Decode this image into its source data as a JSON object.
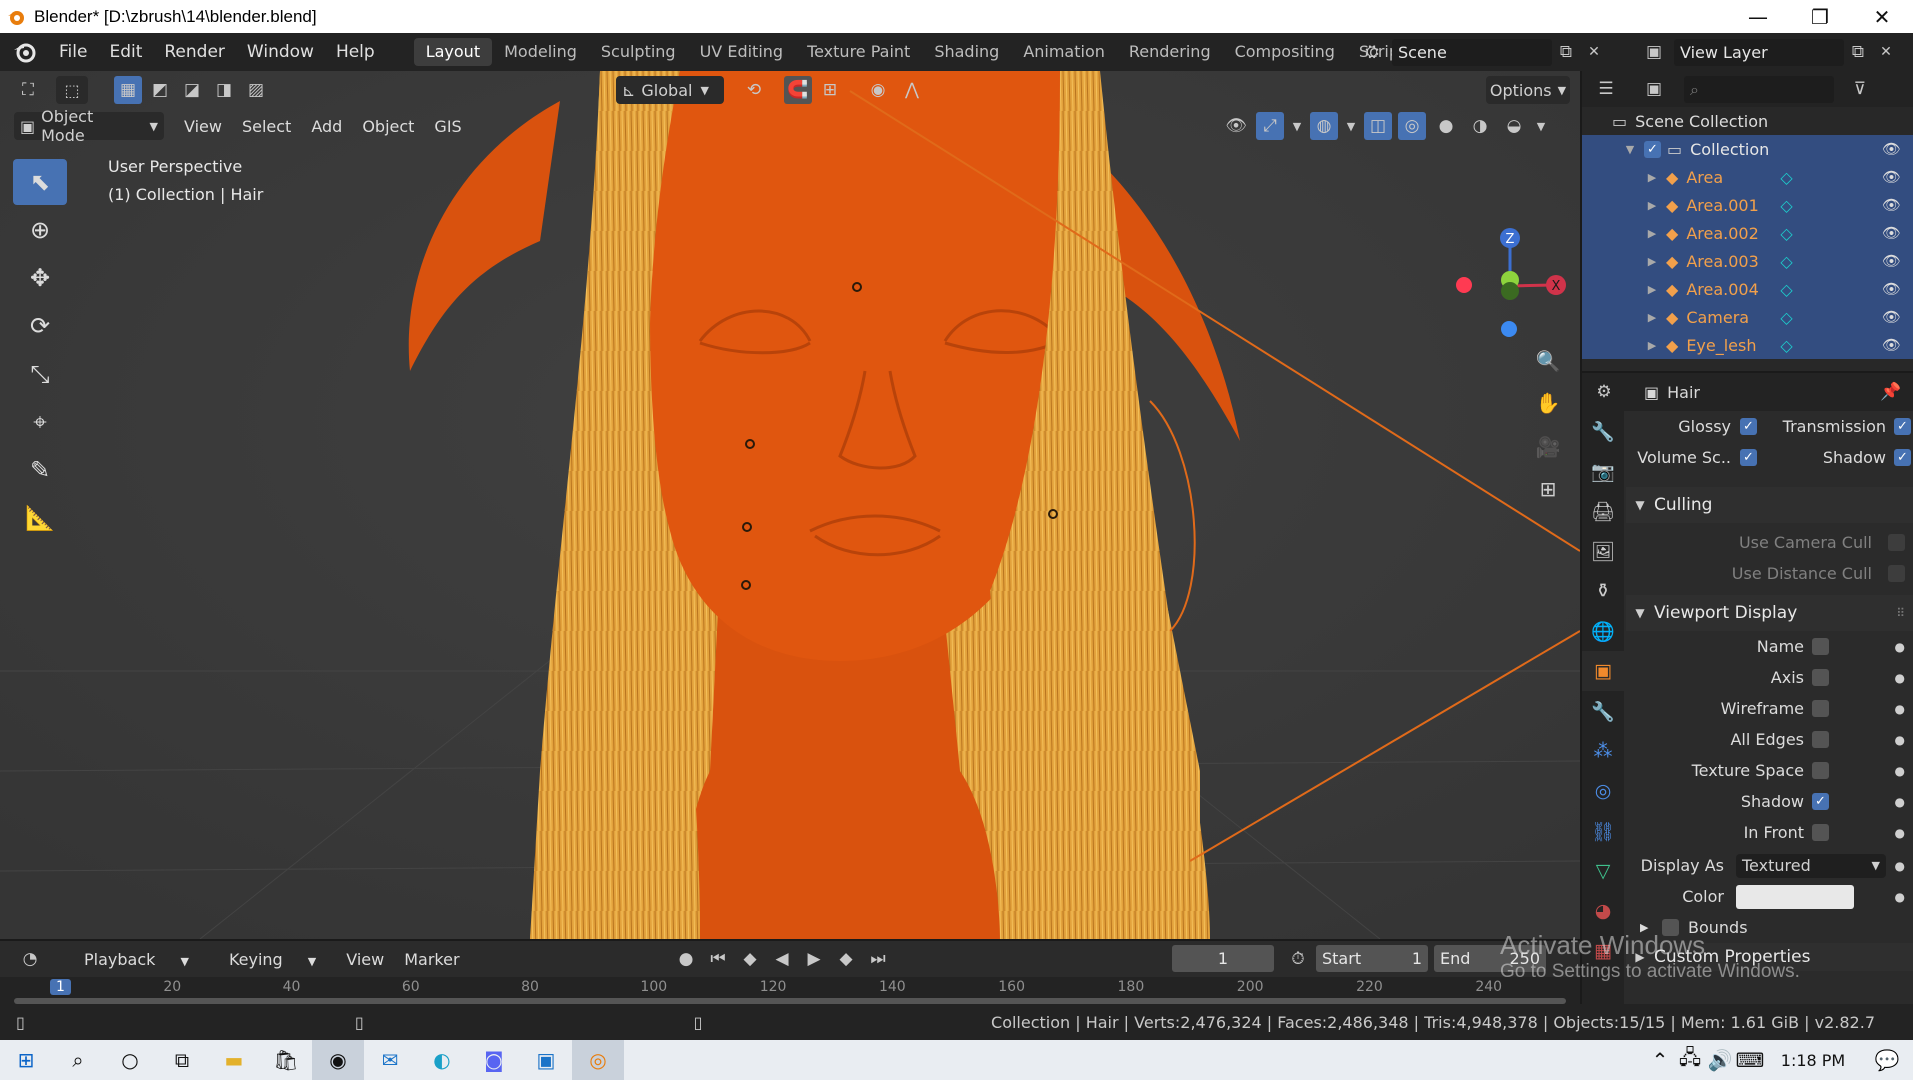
{
  "window": {
    "title": "Blender* [D:\\zbrush\\14\\blender.blend]",
    "minimize": "—",
    "maximize": "❐",
    "close": "✕"
  },
  "menu": [
    "File",
    "Edit",
    "Render",
    "Window",
    "Help"
  ],
  "workspaces": [
    "Layout",
    "Modeling",
    "Sculpting",
    "UV Editing",
    "Texture Paint",
    "Shading",
    "Animation",
    "Rendering",
    "Compositing",
    "Scripting"
  ],
  "active_workspace": "Layout",
  "scene": {
    "name": "Scene",
    "view_layer": "View Layer"
  },
  "viewport": {
    "transform_orientation": "Global",
    "options_label": "Options",
    "mode": "Object Mode",
    "menus": [
      "View",
      "Select",
      "Add",
      "Object",
      "GIS"
    ],
    "info_line1": "User Perspective",
    "info_line2": "(1) Collection | Hair",
    "gizmo_axes": {
      "z": "Z",
      "x": "X"
    }
  },
  "outliner": {
    "root": "Scene Collection",
    "collection": "Collection",
    "items": [
      {
        "name": "Area",
        "icon_color": "#1ec9c9"
      },
      {
        "name": "Area.001",
        "icon_color": "#1ec9c9"
      },
      {
        "name": "Area.002",
        "icon_color": "#1ec9c9"
      },
      {
        "name": "Area.003",
        "icon_color": "#1ec9c9"
      },
      {
        "name": "Area.004",
        "icon_color": "#1ec9c9"
      },
      {
        "name": "Camera",
        "icon_color": "#1ec9c9"
      },
      {
        "name": "Eye_lesh",
        "icon_color": "#1ec9c9"
      }
    ]
  },
  "properties": {
    "object_name": "Hair",
    "visibility": {
      "glossy": "Glossy",
      "transmission": "Transmission",
      "volume": "Volume Sc..",
      "shadow": "Shadow"
    },
    "culling": {
      "title": "Culling",
      "camera_cull": "Use Camera Cull",
      "distance_cull": "Use Distance Cull"
    },
    "viewport_display": {
      "title": "Viewport Display",
      "rows": [
        {
          "label": "Name",
          "checked": false
        },
        {
          "label": "Axis",
          "checked": false
        },
        {
          "label": "Wireframe",
          "checked": false
        },
        {
          "label": "All Edges",
          "checked": false
        },
        {
          "label": "Texture Space",
          "checked": false
        },
        {
          "label": "Shadow",
          "checked": true
        },
        {
          "label": "In Front",
          "checked": false
        }
      ],
      "display_as_label": "Display As",
      "display_as_value": "Textured",
      "color_label": "Color",
      "bounds_label": "Bounds"
    },
    "custom_properties": "Custom Properties"
  },
  "timeline": {
    "menus": [
      "Playback",
      "Keying",
      "View",
      "Marker"
    ],
    "current_frame": "1",
    "start_label": "Start",
    "start_value": "1",
    "end_label": "End",
    "end_value": "250",
    "ruler": [
      "1",
      "20",
      "40",
      "60",
      "80",
      "100",
      "120",
      "140",
      "160",
      "180",
      "200",
      "220",
      "240"
    ]
  },
  "statusbar": "Collection | Hair | Verts:2,476,324 | Faces:2,486,348 | Tris:4,948,378 | Objects:15/15 | Mem: 1.61 GiB | v2.82.7",
  "watermark": {
    "line1": "Activate Windows",
    "line2": "Go to Settings to activate Windows."
  },
  "taskbar": {
    "time": "1:18 PM"
  },
  "colors": {
    "accent": "#4772b3",
    "selection": "#334d80",
    "object_orange": "#f2a04b",
    "hair": "#e8a640",
    "body": "#d9520e"
  }
}
